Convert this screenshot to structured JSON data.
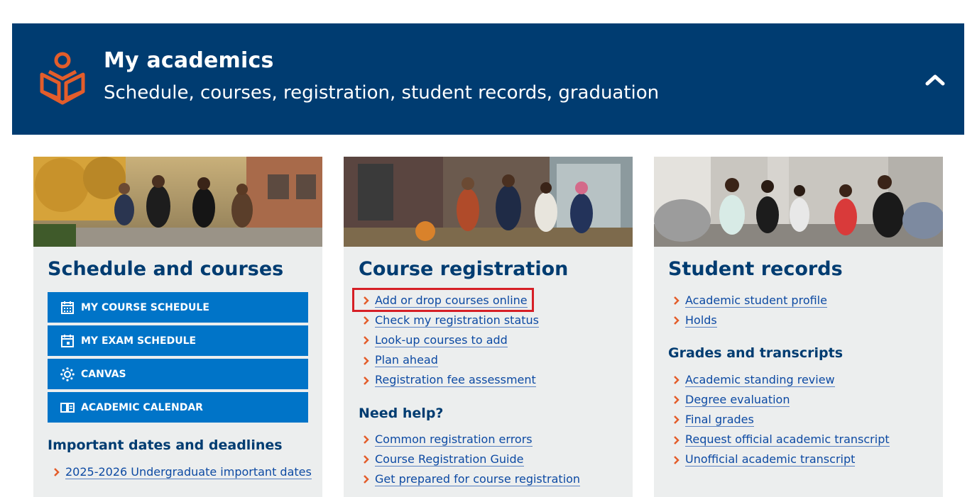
{
  "banner": {
    "title": "My academics",
    "subtitle": "Schedule, courses, registration, student records, graduation",
    "icon": "book-reader-icon",
    "toggle_icon": "chevron-up-icon",
    "bg_color": "#003c71",
    "accent_color": "#e35d2b"
  },
  "schedule_card": {
    "title": "Schedule and courses",
    "photo": "students-walking-photo",
    "buttons": [
      {
        "label": "MY COURSE SCHEDULE",
        "icon": "calendar-grid-icon"
      },
      {
        "label": "MY EXAM SCHEDULE",
        "icon": "calendar-check-icon"
      },
      {
        "label": "CANVAS",
        "icon": "canvas-logo-icon"
      },
      {
        "label": "ACADEMIC CALENDAR",
        "icon": "open-book-icon"
      }
    ],
    "dates_heading": "Important dates and deadlines",
    "dates_links": [
      "2025-2026 Undergraduate important dates"
    ]
  },
  "registration_card": {
    "title": "Course registration",
    "photo": "students-outside-photo",
    "links": [
      "Add or drop courses online",
      "Check my registration status",
      "Look-up courses to add",
      "Plan ahead",
      "Registration fee assessment"
    ],
    "help_heading": "Need help?",
    "help_links": [
      "Common registration errors",
      "Course Registration Guide",
      "Get prepared for course registration"
    ]
  },
  "records_card": {
    "title": "Student records",
    "photo": "students-lounge-photo",
    "links": [
      "Academic student profile",
      "Holds"
    ],
    "grades_heading": "Grades and transcripts",
    "grades_links": [
      "Academic standing review",
      "Degree evaluation",
      "Final grades",
      "Request official academic transcript",
      "Unofficial academic transcript"
    ]
  },
  "colors": {
    "button_blue": "#0074c8",
    "card_bg": "#eceeee",
    "link_blue": "#0d4aa3",
    "chevron_orange": "#e35d2b",
    "highlight_red": "#d61f26"
  }
}
